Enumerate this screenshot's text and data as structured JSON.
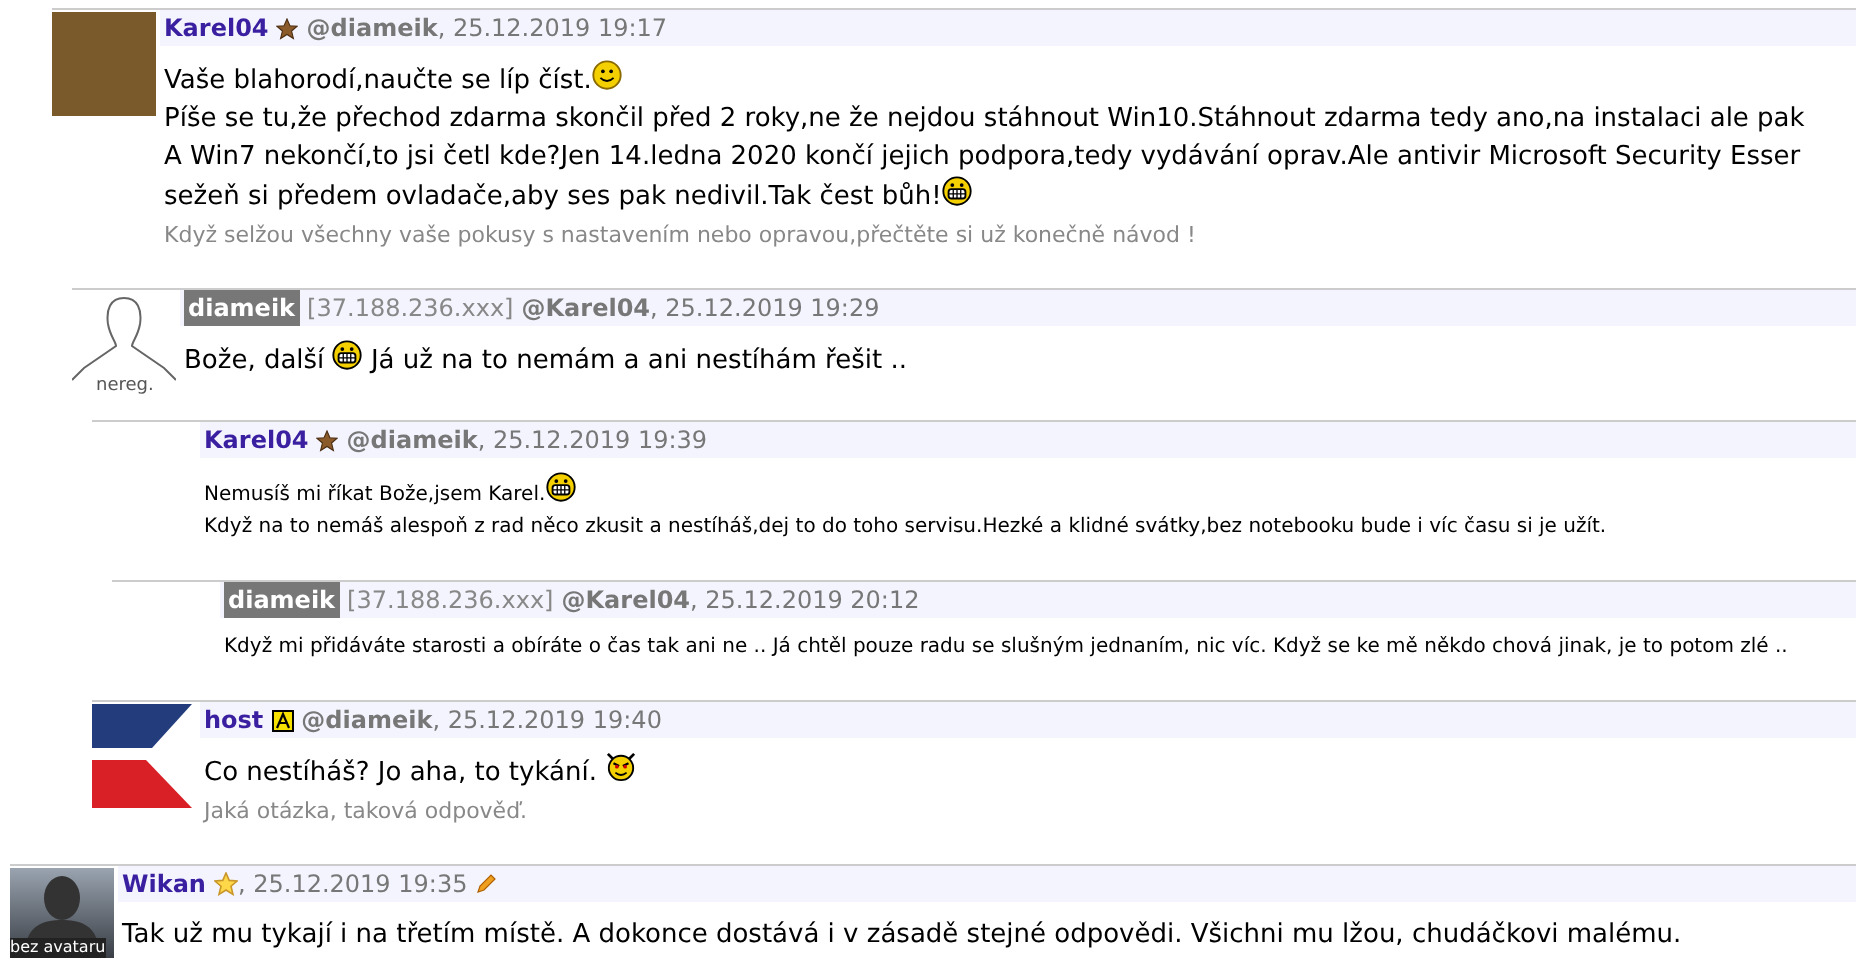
{
  "earlier_thread": [
    {
      "author": "Karel04",
      "registered": true,
      "badge": {
        "kind": "star"
      },
      "reply_to": "@diameik",
      "date": ", 25.12.2019 19:17",
      "edited": false,
      "avatar": {
        "kind": "photo"
      },
      "body": [
        [
          {
            "kind": "text",
            "text": "Vaše blahorodí,naučte se líp číst."
          },
          {
            "kind": "smile"
          }
        ],
        [
          {
            "kind": "text",
            "text": "Píše se tu,že přechod zdarma skončil před 2 roky,ne že nejdou stáhnout Win10.Stáhnout zdarma tedy ano,na instalaci ale pak"
          }
        ],
        [
          {
            "kind": "text",
            "text": "A Win7 nekončí,to jsi četl kde?Jen 14.ledna 2020 končí jejich podpora,tedy vydávání oprav.Ale antivir Microsoft Security Esser"
          }
        ],
        [
          {
            "kind": "text",
            "text": "sežeň si předem ovladače,aby ses pak nedivil.Tak čest bůh!"
          },
          {
            "kind": "grin"
          }
        ]
      ],
      "signature": "Když selžou všechny vaše pokusy s nastavením nebo opravou,přečtěte si už konečně návod !",
      "children": [
        {
          "author": "diameik",
          "registered": false,
          "ip": "[37.188.236.xxx]",
          "reply_to": "@Karel04",
          "date": ", 25.12.2019 19:29",
          "edited": false,
          "avatar": {
            "kind": "unregistered",
            "label": "nereg."
          },
          "body": [
            [
              {
                "kind": "text",
                "text": "Bože, další "
              },
              {
                "kind": "grin"
              },
              {
                "kind": "text",
                "text": " Já už na to nemám a ani nestíhám řešit .."
              }
            ]
          ],
          "children": [
            {
              "author": "Karel04",
              "registered": true,
              "badge": {
                "kind": "star"
              },
              "reply_to": "@diameik",
              "date": ", 25.12.2019 19:39",
              "edited": false,
              "body": [
                [
                  {
                    "kind": "text",
                    "text": "Nemusíš mi říkat Bože,jsem Karel."
                  },
                  {
                    "kind": "grin"
                  }
                ],
                [
                  {
                    "kind": "text",
                    "text": "Když na to nemáš alespoň z rad něco zkusit a nestíháš,dej to do toho servisu.Hezké a klidné svátky,bez notebooku bude i víc času si je užít."
                  }
                ]
              ],
              "children": [
                {
                  "author": "diameik",
                  "registered": false,
                  "ip": "[37.188.236.xxx]",
                  "reply_to": "@Karel04",
                  "date": ", 25.12.2019 20:12",
                  "edited": false,
                  "body": [
                    [
                      {
                        "kind": "text",
                        "text": "Když mi přidáváte starosti a obíráte o čas tak ani ne .. Já chtěl pouze radu se slušným jednaním, nic víc. Když se ke mě někdo chová jinak, je to potom zlé .."
                      }
                    ]
                  ]
                }
              ]
            },
            {
              "author": "host",
              "registered": true,
              "badge": {
                "kind": "admin"
              },
              "reply_to": "@diameik",
              "date": ", 25.12.2019 19:40",
              "edited": false,
              "avatar": {
                "kind": "flag"
              },
              "body": [
                [
                  {
                    "kind": "text",
                    "text": "Co nestíháš? Jo aha, to tykání. "
                  },
                  {
                    "kind": "devil"
                  }
                ]
              ],
              "signature": "Jaká otázka, taková odpověď."
            }
          ]
        }
      ]
    }
  ],
  "comments": [
    {
      "author": "Wikan",
      "registered": true,
      "badge": {
        "kind": "gold_star"
      },
      "date": ", 25.12.2019 19:35",
      "edited": true,
      "avatar": {
        "kind": "no_avatar",
        "label": "bez avataru"
      },
      "body": [
        [
          {
            "kind": "text",
            "text": "Tak už mu tykají i na třetím místě. A dokonce dostává i v zásadě stejné odpovědi. Všichni mu lžou, chudáčkovi malému."
          }
        ]
      ]
    }
  ]
}
